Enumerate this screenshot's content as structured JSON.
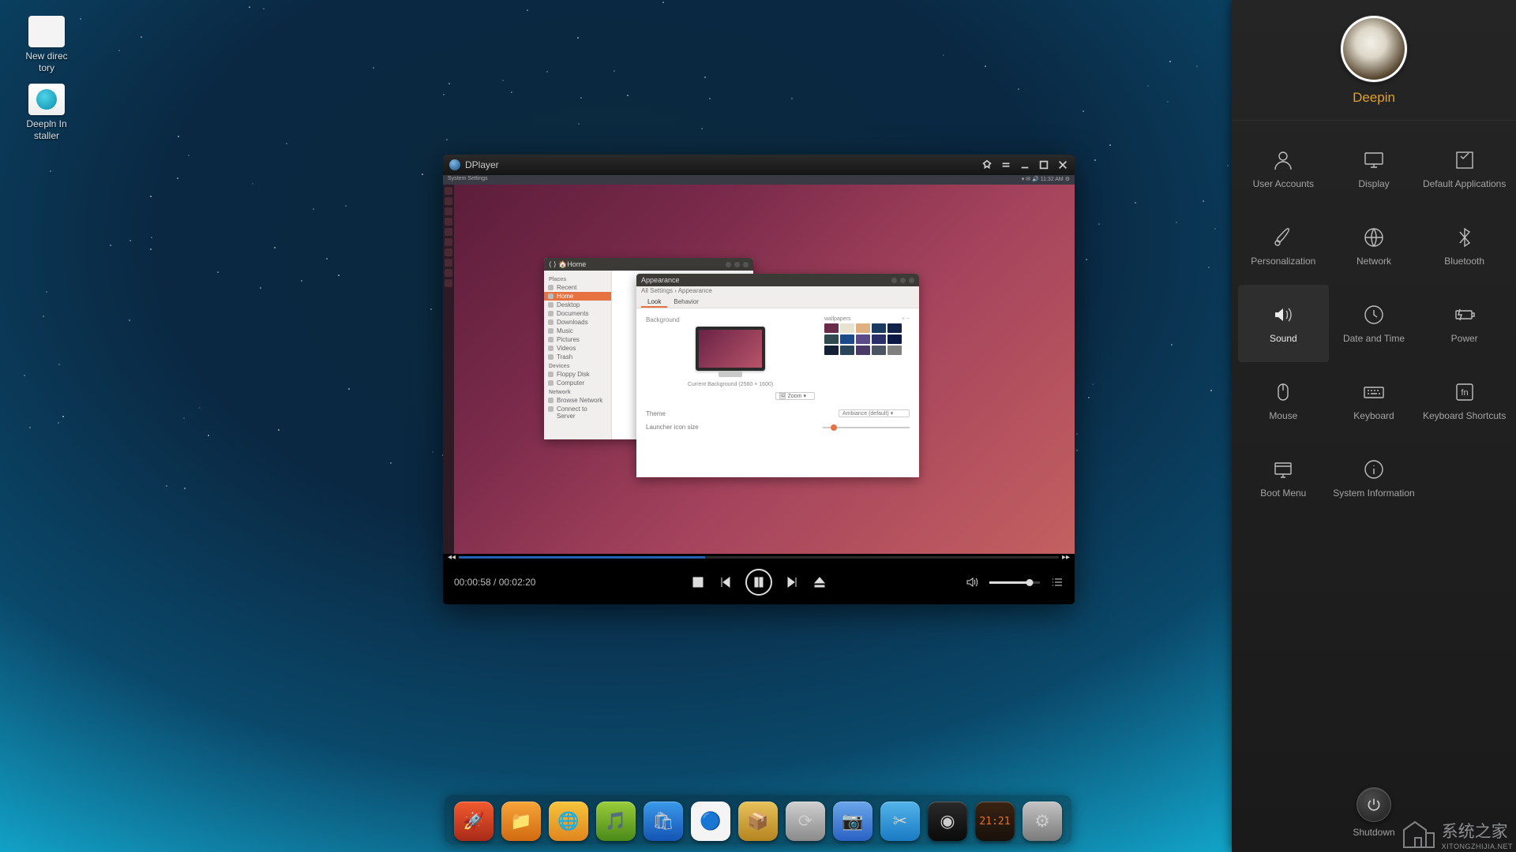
{
  "desktop": {
    "icons": [
      {
        "name": "folder-new-directory",
        "label": "New direc\ntory"
      },
      {
        "name": "deepin-installer",
        "label": "Deepin In\nstaller"
      }
    ]
  },
  "dplayer": {
    "title": "DPlayer",
    "time_current": "00:00:58",
    "time_total": "00:02:20",
    "time_sep": " / ",
    "progress_pct": 41,
    "volume_pct": 80,
    "video_topbar_left": "System Settings",
    "video_topbar_right": "▾  ✉  🔊  11:32 AM  ⚙",
    "win1": {
      "title": "Home",
      "sections": [
        {
          "header": "Places",
          "items": [
            "Recent",
            "Home",
            "Desktop",
            "Documents",
            "Downloads",
            "Music",
            "Pictures",
            "Videos",
            "Trash"
          ]
        },
        {
          "header": "Devices",
          "items": [
            "Floppy Disk",
            "Computer"
          ]
        },
        {
          "header": "Network",
          "items": [
            "Browse Network",
            "Connect to Server"
          ]
        }
      ],
      "selected": "Home"
    },
    "win2": {
      "title": "Appearance",
      "breadcrumb": "All Settings › Appearance",
      "tabs": [
        "Look",
        "Behavior"
      ],
      "active_tab": "Look",
      "bg_label": "Background",
      "current_bg": "Current Background (2560 × 1600)",
      "zoom_label": "Zoom",
      "wall_header": "wallpapers",
      "theme_label": "Theme",
      "theme_value": "Ambiance (default)",
      "launcher_size_label": "Launcher icon size",
      "wall_colors": [
        "#6a2a4a",
        "#e8e2d0",
        "#e0b080",
        "#1a3a62",
        "#10244a",
        "#304a50",
        "#1a4a8a",
        "#5a4a88",
        "#2a2f6a",
        "#0a1a44",
        "#142034",
        "#2a445a",
        "#4a3a68",
        "#4a5462",
        "#808080"
      ]
    }
  },
  "dock_apps": [
    {
      "name": "launcher",
      "color": "linear-gradient(#f25a2e,#a82a18)",
      "glyph": "🚀"
    },
    {
      "name": "files",
      "color": "linear-gradient(#f6a437,#d16a12)",
      "glyph": "📁"
    },
    {
      "name": "browser",
      "color": "linear-gradient(#f6c43b,#e0861e)",
      "glyph": "🌐"
    },
    {
      "name": "music",
      "color": "linear-gradient(#9acc3a,#4a8a18)",
      "glyph": "🎵"
    },
    {
      "name": "store",
      "color": "linear-gradient(#3a9aea,#1454b4)",
      "glyph": "🛍"
    },
    {
      "name": "chrome",
      "color": "#f4f4f4",
      "glyph": "🔵"
    },
    {
      "name": "archive",
      "color": "linear-gradient(#e8c25a,#b48420)",
      "glyph": "📦"
    },
    {
      "name": "updater",
      "color": "linear-gradient(#d0d0d0,#8a8a8a)",
      "glyph": "⟳"
    },
    {
      "name": "camera",
      "color": "linear-gradient(#6aa6ea,#2a62c4)",
      "glyph": "📷"
    },
    {
      "name": "screenshot",
      "color": "linear-gradient(#52b4e8,#1a7ac4)",
      "glyph": "✂"
    },
    {
      "name": "dplayer",
      "color": "linear-gradient(#2a2a2a,#0a0a0a)",
      "glyph": "◉"
    },
    {
      "name": "clock",
      "color": "linear-gradient(#3a2412,#18100a)",
      "glyph": "21:21"
    },
    {
      "name": "settings",
      "color": "linear-gradient(#c4c4c4,#7a7a7a)",
      "glyph": "⚙"
    }
  ],
  "cc": {
    "username": "Deepin",
    "items": [
      {
        "id": "user-accounts",
        "label": "User Accounts",
        "icon": "user"
      },
      {
        "id": "display",
        "label": "Display",
        "icon": "display"
      },
      {
        "id": "default-apps",
        "label": "Default\nApplications",
        "icon": "defaults"
      },
      {
        "id": "personalization",
        "label": "Personalization",
        "icon": "brush"
      },
      {
        "id": "network",
        "label": "Network",
        "icon": "globe"
      },
      {
        "id": "bluetooth",
        "label": "Bluetooth",
        "icon": "bluetooth"
      },
      {
        "id": "sound",
        "label": "Sound",
        "icon": "sound",
        "active": true
      },
      {
        "id": "datetime",
        "label": "Date and Time",
        "icon": "clock"
      },
      {
        "id": "power",
        "label": "Power",
        "icon": "battery"
      },
      {
        "id": "mouse",
        "label": "Mouse",
        "icon": "mouse"
      },
      {
        "id": "keyboard",
        "label": "Keyboard",
        "icon": "keyboard"
      },
      {
        "id": "shortcuts",
        "label": "Keyboard\nShortcuts",
        "icon": "fn"
      },
      {
        "id": "boot",
        "label": "Boot Menu",
        "icon": "boot"
      },
      {
        "id": "sysinfo",
        "label": "System\nInformation",
        "icon": "info"
      }
    ],
    "shutdown_label": "Shutdown"
  },
  "watermark": {
    "text": "系统之家",
    "sub": "XITONGZHIJIA.NET"
  }
}
